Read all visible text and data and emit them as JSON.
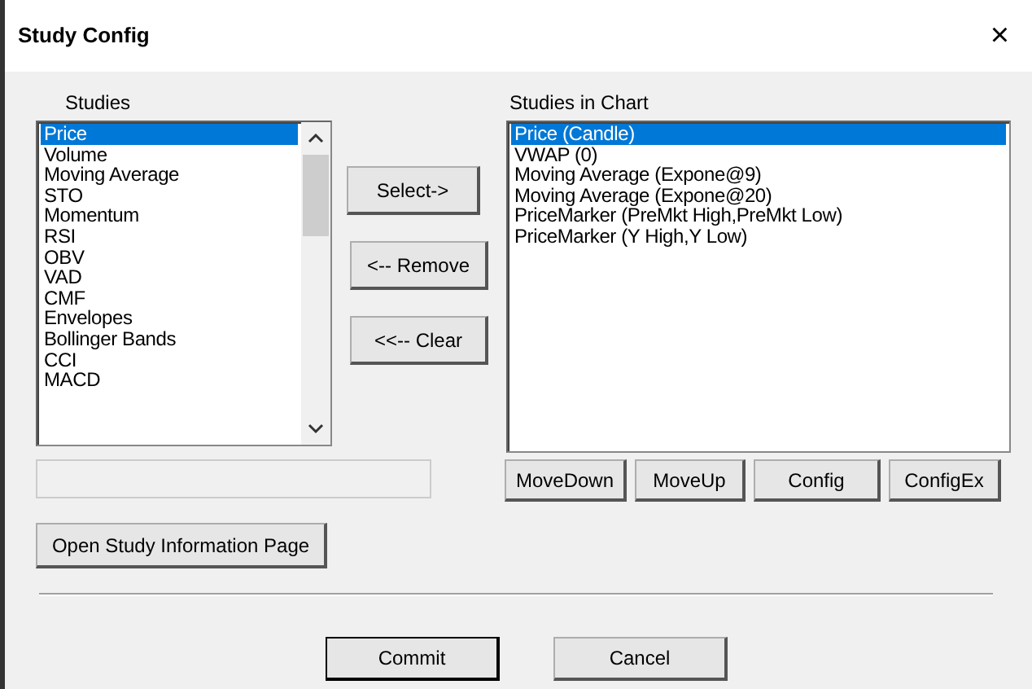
{
  "window": {
    "title": "Study Config",
    "close": "×"
  },
  "studies": {
    "label": "Studies",
    "items": [
      {
        "text": "Price",
        "selected": true
      },
      {
        "text": "Volume",
        "selected": false
      },
      {
        "text": "Moving Average",
        "selected": false
      },
      {
        "text": "STO",
        "selected": false
      },
      {
        "text": "Momentum",
        "selected": false
      },
      {
        "text": "RSI",
        "selected": false
      },
      {
        "text": "OBV",
        "selected": false
      },
      {
        "text": "VAD",
        "selected": false
      },
      {
        "text": "CMF",
        "selected": false
      },
      {
        "text": "Envelopes",
        "selected": false
      },
      {
        "text": "Bollinger Bands",
        "selected": false
      },
      {
        "text": "CCI",
        "selected": false
      },
      {
        "text": "MACD",
        "selected": false
      }
    ]
  },
  "middle_buttons": [
    "Select->",
    "<-- Remove",
    "<<-- Clear"
  ],
  "chart": {
    "label": "Studies in Chart",
    "items": [
      {
        "text": "Price (Candle)",
        "selected": true
      },
      {
        "text": "VWAP (0)",
        "selected": false
      },
      {
        "text": "Moving Average (Expone@9)",
        "selected": false
      },
      {
        "text": "Moving Average (Expone@20)",
        "selected": false
      },
      {
        "text": "PriceMarker (PreMkt High,PreMkt Low)",
        "selected": false
      },
      {
        "text": "PriceMarker (Y High,Y Low)",
        "selected": false
      }
    ]
  },
  "info_field": {
    "disabled": true
  },
  "chart_buttons": [
    "MoveDown",
    "MoveUp",
    "Config",
    "ConfigEx"
  ],
  "info_button": "Open Study Information Page",
  "footer_buttons": [
    {
      "label": "Commit",
      "default": true
    },
    {
      "label": "Cancel",
      "default": false
    }
  ]
}
